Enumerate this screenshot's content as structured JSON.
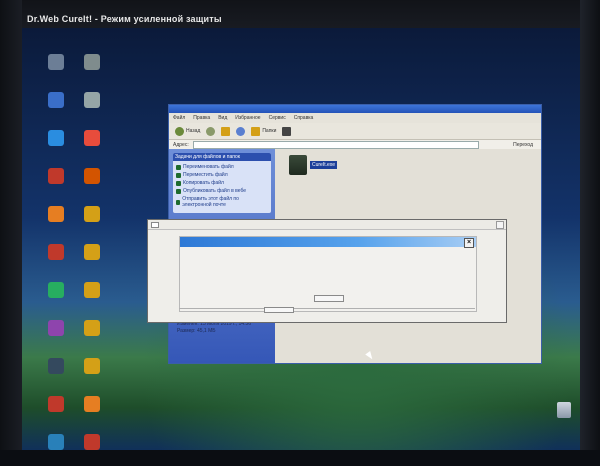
{
  "window": {
    "title": "Dr.Web CureIt! - Режим усиленной защиты"
  },
  "explorer": {
    "menu": [
      "Файл",
      "Правка",
      "Вид",
      "Избранное",
      "Сервис",
      "Справка"
    ],
    "toolbar": {
      "back": "Назад",
      "folders": "Папки"
    },
    "address_label": "Адрес:",
    "go_label": "Переход",
    "task_pane": {
      "title": "Задачи для файлов и папок",
      "items": [
        {
          "label": "Переименовать файл"
        },
        {
          "label": "Переместить файл"
        },
        {
          "label": "Копировать файл"
        },
        {
          "label": "Опубликовать файл в вебе"
        },
        {
          "label": "Отправить этот файл по электронной почте"
        }
      ],
      "details": [
        "Изменен: 13 июля 2019 г., 14:36",
        "Размер: 45,1 МБ"
      ]
    },
    "files": [
      {
        "name": "CureIt.exe"
      }
    ]
  },
  "dialog": {
    "close_label": "×"
  },
  "colors": {
    "accent": "#2e79d6",
    "desktop_bottom": "#10305a"
  }
}
